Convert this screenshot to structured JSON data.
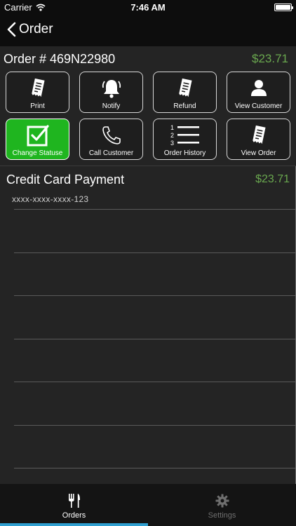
{
  "status_bar": {
    "carrier": "Carrier",
    "time": "7:46 AM"
  },
  "nav": {
    "back_label": "Order"
  },
  "order": {
    "number": "Order # 469N22980",
    "total": "$23.71"
  },
  "actions": [
    {
      "label": "Print",
      "icon": "receipt-icon",
      "active": false
    },
    {
      "label": "Notify",
      "icon": "bell-icon",
      "active": false
    },
    {
      "label": "Refund",
      "icon": "receipt-icon",
      "active": false
    },
    {
      "label": "View Customer",
      "icon": "person-icon",
      "active": false
    },
    {
      "label": "Change Statuse",
      "icon": "checkbox-icon",
      "active": true
    },
    {
      "label": "Call Customer",
      "icon": "phone-icon",
      "active": false
    },
    {
      "label": "Order History",
      "icon": "numbered-list-icon",
      "active": false
    },
    {
      "label": "View Order",
      "icon": "receipt-icon",
      "active": false
    }
  ],
  "payment": {
    "title": "Credit Card Payment",
    "amount": "$23.71",
    "card_number": "xxxx-xxxx-xxxx-123"
  },
  "tabs": [
    {
      "label": "Orders",
      "icon": "fork-knife-icon",
      "selected": true
    },
    {
      "label": "Settings",
      "icon": "gear-icon",
      "selected": false
    }
  ],
  "colors": {
    "accent_green": "#6aa84f",
    "active_tile": "#1fb51f",
    "tab_indicator": "#2f9fd0"
  }
}
